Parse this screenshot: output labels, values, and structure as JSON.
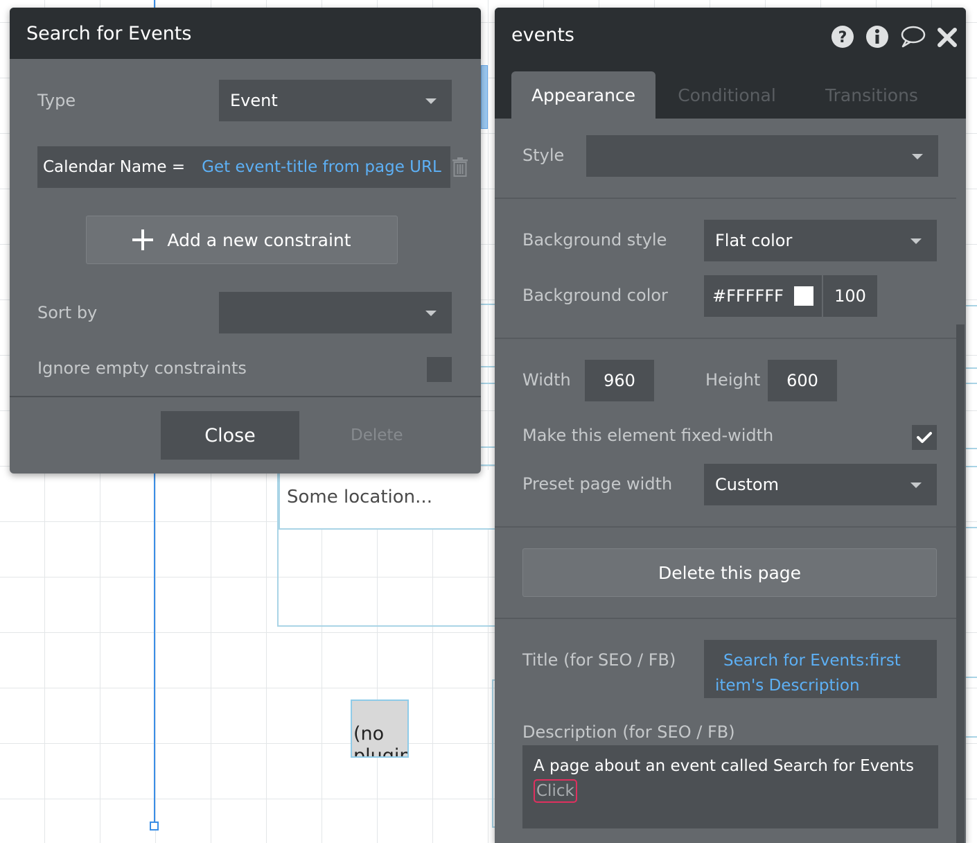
{
  "canvas": {
    "location_placeholder": "Some location...",
    "plugin_placeholder": "(no plugin)"
  },
  "search_panel": {
    "title": "Search for Events",
    "type_label": "Type",
    "type_value": "Event",
    "constraint": {
      "field": "Calendar Name =",
      "value": "Get event-title from page URL"
    },
    "add_constraint_label": "Add a new constraint",
    "sort_by_label": "Sort by",
    "sort_by_value": "",
    "ignore_empty_label": "Ignore empty constraints",
    "ignore_empty_checked": false,
    "close_label": "Close",
    "delete_label": "Delete"
  },
  "property_panel": {
    "title": "events",
    "header_icons": [
      "help-icon",
      "info-icon",
      "comment-icon",
      "close-icon"
    ],
    "tabs": [
      {
        "label": "Appearance",
        "active": true
      },
      {
        "label": "Conditional",
        "active": false
      },
      {
        "label": "Transitions",
        "active": false
      }
    ],
    "style_label": "Style",
    "style_value": "",
    "background_style_label": "Background style",
    "background_style_value": "Flat color",
    "background_color_label": "Background color",
    "background_color_hex": "#FFFFFF",
    "background_opacity": "100",
    "width_label": "Width",
    "width_value": "960",
    "height_label": "Height",
    "height_value": "600",
    "fixed_width_label": "Make this element fixed-width",
    "fixed_width_checked": true,
    "preset_width_label": "Preset page width",
    "preset_width_value": "Custom",
    "delete_page_label": "Delete this page",
    "seo_title_label": "Title (for SEO / FB)",
    "seo_title_value": "Search for Events:first item's Description",
    "seo_description_label": "Description (for SEO / FB)",
    "seo_description_value": "A page about an event called Search for Events",
    "seo_description_chip": "Click"
  },
  "colors": {
    "panel_bg": "#64686c",
    "header_bg": "#2b2f32",
    "field_bg": "#4c5054",
    "dynamic_text": "#5db0f5",
    "canvas_selection": "#3a8ee6"
  }
}
